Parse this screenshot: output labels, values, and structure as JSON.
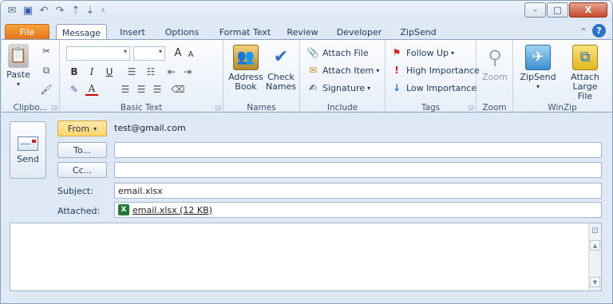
{
  "quick_access": {
    "file_icon": "outlook-app-icon",
    "save_icon": "save-icon",
    "undo_icon": "undo-icon",
    "redo_icon": "redo-icon",
    "up_icon": "arrow-up-icon",
    "down_icon": "arrow-down-icon",
    "customize_icon": "customize-toolbar-icon"
  },
  "window_controls": {
    "minimize": "–",
    "maximize": "□",
    "close": "X"
  },
  "tabs": [
    {
      "label": "File"
    },
    {
      "label": "Message"
    },
    {
      "label": "Insert"
    },
    {
      "label": "Options"
    },
    {
      "label": "Format Text"
    },
    {
      "label": "Review"
    },
    {
      "label": "Developer"
    },
    {
      "label": "ZipSend"
    }
  ],
  "ribbon": {
    "clipboard": {
      "label": "Clipbo...",
      "paste": "Paste"
    },
    "basic_text": {
      "label": "Basic Text",
      "bold": "B",
      "italic": "I",
      "underline": "U",
      "grow": "A",
      "shrink": "A",
      "font_color": "A"
    },
    "names": {
      "label": "Names",
      "address_book": "Address Book",
      "check_names": "Check Names"
    },
    "include": {
      "label": "Include",
      "attach_file": "Attach File",
      "attach_item": "Attach Item",
      "signature": "Signature"
    },
    "tags": {
      "label": "Tags",
      "follow_up": "Follow Up",
      "high_importance": "High Importance",
      "low_importance": "Low Importance"
    },
    "zoom": {
      "label": "Zoom",
      "zoom_btn": "Zoom"
    },
    "winzip": {
      "label": "WinZip",
      "zipsend": "ZipSend",
      "attach_large": "Attach Large File"
    }
  },
  "compose": {
    "send": "Send",
    "from_btn": "From",
    "from_value": "test@gmail.com",
    "to_btn": "To...",
    "to_value": "",
    "cc_btn": "Cc...",
    "cc_value": "",
    "subject_label": "Subject:",
    "subject_value": "email.xlsx",
    "attached_label": "Attached:",
    "attachment": "email.xlsx (12 KB)"
  },
  "colors": {
    "file_tab": "#e3741e",
    "from_button": "#ffd56b",
    "ribbon_bg": "#e7eef8",
    "window_bg": "#dfe9f5",
    "excel_green": "#1f7a3a"
  }
}
